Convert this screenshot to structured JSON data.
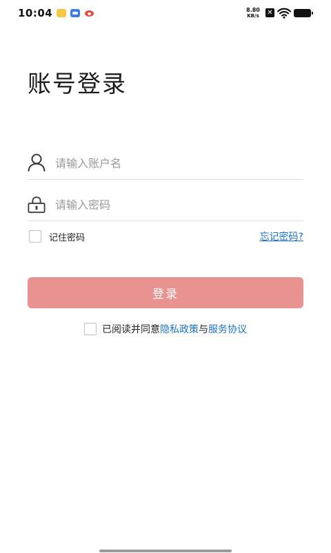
{
  "status_bar": {
    "time": "10:04",
    "apps": [
      "notes-icon",
      "cloud-icon",
      "weibo-icon"
    ],
    "network_speed_value": "8.80",
    "network_speed_unit": "KB/s",
    "icons": [
      "close-box-icon",
      "wifi-icon",
      "battery-icon"
    ]
  },
  "login": {
    "title": "账号登录",
    "username_placeholder": "请输入账户名",
    "password_placeholder": "请输入密码",
    "remember_label": "记住密码",
    "forgot_label": "忘记密码?",
    "login_button": "登录",
    "agreement_prefix": "已阅读并同意",
    "privacy_policy": "隐私政策",
    "agreement_and": "与",
    "service_agreement": "服务协议"
  },
  "colors": {
    "primary_button": "#e89291",
    "link": "#1a73c9",
    "divider": "#dcdcdc"
  }
}
